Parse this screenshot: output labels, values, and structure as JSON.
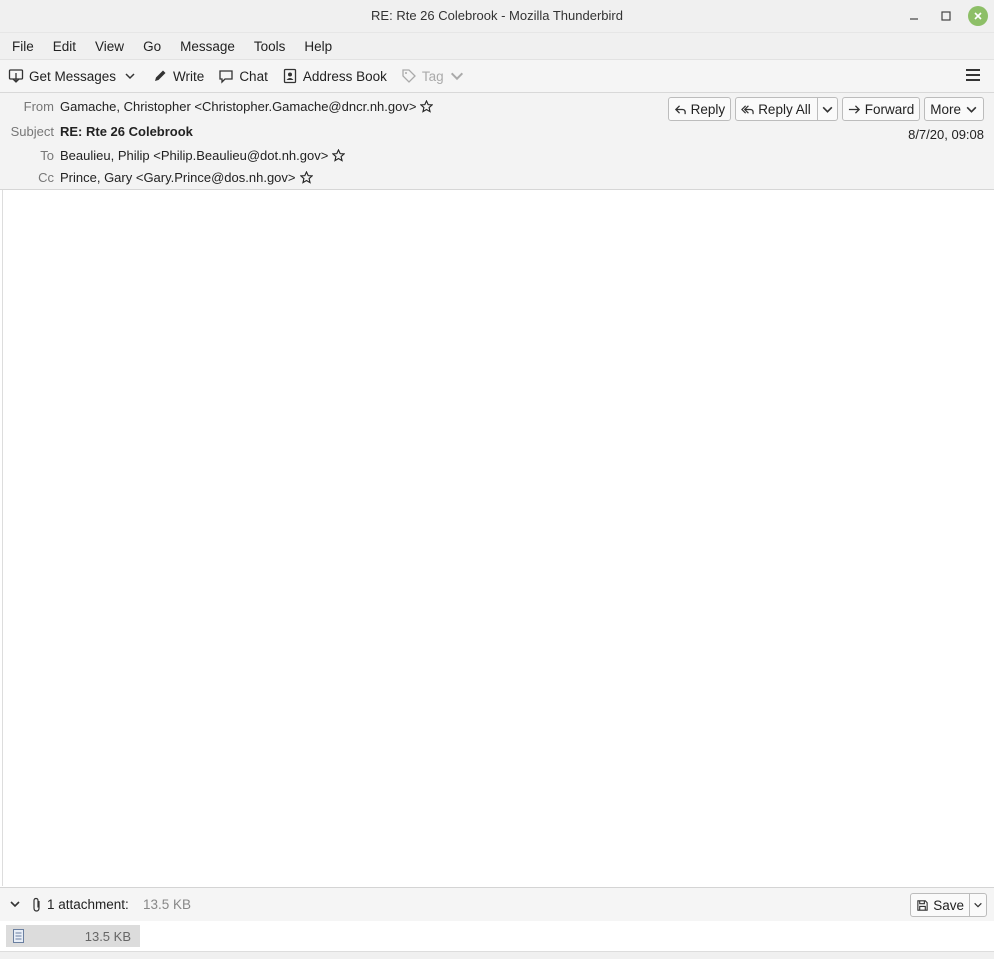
{
  "window": {
    "title": "RE: Rte 26 Colebrook - Mozilla Thunderbird"
  },
  "menu": [
    "File",
    "Edit",
    "View",
    "Go",
    "Message",
    "Tools",
    "Help"
  ],
  "toolbar": {
    "get_messages": "Get Messages",
    "write": "Write",
    "chat": "Chat",
    "address_book": "Address Book",
    "tag": "Tag"
  },
  "message": {
    "labels": {
      "from": "From",
      "subject": "Subject",
      "to": "To",
      "cc": "Cc"
    },
    "from": "Gamache, Christopher <Christopher.Gamache@dncr.nh.gov>",
    "subject": "RE: Rte 26 Colebrook",
    "to": "Beaulieu, Philip <Philip.Beaulieu@dot.nh.gov>",
    "cc": "Prince, Gary <Gary.Prince@dos.nh.gov>",
    "date": "8/7/20, 09:08"
  },
  "header_buttons": {
    "reply": "Reply",
    "reply_all": "Reply All",
    "forward": "Forward",
    "more": "More"
  },
  "attachments": {
    "count_label": "1 attachment:",
    "total_size": "13.5 KB",
    "save": "Save",
    "items": [
      {
        "size": "13.5 KB"
      }
    ]
  }
}
